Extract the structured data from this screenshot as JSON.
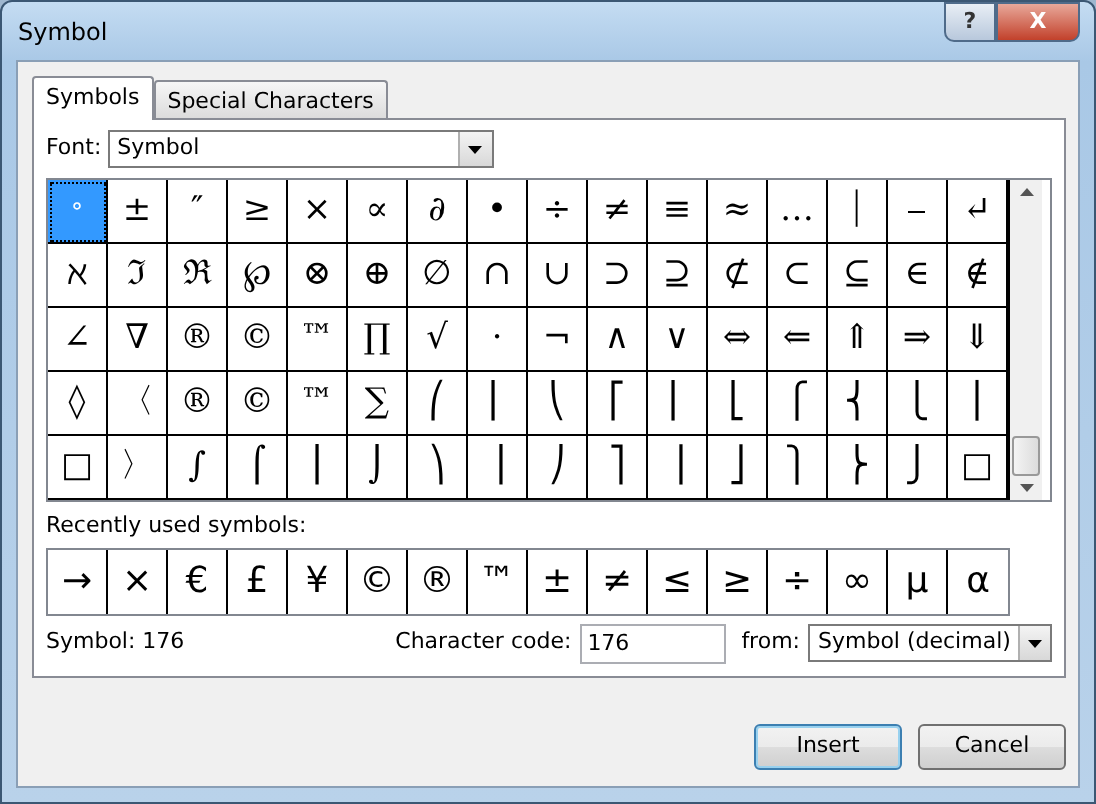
{
  "window": {
    "title": "Symbol",
    "help": "?",
    "close": "X"
  },
  "tabs": [
    {
      "label": "Symbols",
      "selected": true
    },
    {
      "label": "Special Characters",
      "selected": false
    }
  ],
  "font": {
    "label": "Font:",
    "value": "Symbol"
  },
  "grid": {
    "rows": [
      [
        {
          "symbol": "°",
          "selected": true
        },
        {
          "symbol": "±",
          "selected": false
        },
        {
          "symbol": "″",
          "selected": false
        },
        {
          "symbol": "≥",
          "selected": false
        },
        {
          "symbol": "×",
          "selected": false
        },
        {
          "symbol": "∝",
          "selected": false
        },
        {
          "symbol": "∂",
          "selected": false
        },
        {
          "symbol": "•",
          "selected": false
        },
        {
          "symbol": "÷",
          "selected": false
        },
        {
          "symbol": "≠",
          "selected": false
        },
        {
          "symbol": "≡",
          "selected": false
        },
        {
          "symbol": "≈",
          "selected": false
        },
        {
          "symbol": "…",
          "selected": false
        },
        {
          "symbol": "⏐",
          "selected": false
        },
        {
          "symbol": "⎯",
          "selected": false
        },
        {
          "symbol": "↵",
          "selected": false
        }
      ],
      [
        {
          "symbol": "ℵ",
          "selected": false
        },
        {
          "symbol": "ℑ",
          "selected": false
        },
        {
          "symbol": "ℜ",
          "selected": false
        },
        {
          "symbol": "℘",
          "selected": false
        },
        {
          "symbol": "⊗",
          "selected": false
        },
        {
          "symbol": "⊕",
          "selected": false
        },
        {
          "symbol": "∅",
          "selected": false
        },
        {
          "symbol": "∩",
          "selected": false
        },
        {
          "symbol": "∪",
          "selected": false
        },
        {
          "symbol": "⊃",
          "selected": false
        },
        {
          "symbol": "⊇",
          "selected": false
        },
        {
          "symbol": "⊄",
          "selected": false
        },
        {
          "symbol": "⊂",
          "selected": false
        },
        {
          "symbol": "⊆",
          "selected": false
        },
        {
          "symbol": "∈",
          "selected": false
        },
        {
          "symbol": "∉",
          "selected": false
        }
      ],
      [
        {
          "symbol": "∠",
          "selected": false
        },
        {
          "symbol": "∇",
          "selected": false
        },
        {
          "symbol": "®",
          "selected": false
        },
        {
          "symbol": "©",
          "selected": false
        },
        {
          "symbol": "™",
          "selected": false
        },
        {
          "symbol": "∏",
          "selected": false
        },
        {
          "symbol": "√",
          "selected": false
        },
        {
          "symbol": "⋅",
          "selected": false
        },
        {
          "symbol": "¬",
          "selected": false
        },
        {
          "symbol": "∧",
          "selected": false
        },
        {
          "symbol": "∨",
          "selected": false
        },
        {
          "symbol": "⇔",
          "selected": false
        },
        {
          "symbol": "⇐",
          "selected": false
        },
        {
          "symbol": "⇑",
          "selected": false
        },
        {
          "symbol": "⇒",
          "selected": false
        },
        {
          "symbol": "⇓",
          "selected": false
        }
      ],
      [
        {
          "symbol": "◊",
          "selected": false
        },
        {
          "symbol": "〈",
          "selected": false
        },
        {
          "symbol": "®",
          "selected": false
        },
        {
          "symbol": "©",
          "selected": false
        },
        {
          "symbol": "™",
          "selected": false
        },
        {
          "symbol": "∑",
          "selected": false
        },
        {
          "symbol": "⎛",
          "selected": false
        },
        {
          "symbol": "⎜",
          "selected": false
        },
        {
          "symbol": "⎝",
          "selected": false
        },
        {
          "symbol": "⎡",
          "selected": false
        },
        {
          "symbol": "⎢",
          "selected": false
        },
        {
          "symbol": "⎣",
          "selected": false
        },
        {
          "symbol": "⎧",
          "selected": false
        },
        {
          "symbol": "⎨",
          "selected": false
        },
        {
          "symbol": "⎩",
          "selected": false
        },
        {
          "symbol": "⎪",
          "selected": false
        }
      ],
      [
        {
          "symbol": "□",
          "selected": false
        },
        {
          "symbol": "〉",
          "selected": false
        },
        {
          "symbol": "∫",
          "selected": false
        },
        {
          "symbol": "⌠",
          "selected": false
        },
        {
          "symbol": "⎮",
          "selected": false
        },
        {
          "symbol": "⌡",
          "selected": false
        },
        {
          "symbol": "⎞",
          "selected": false
        },
        {
          "symbol": "⎟",
          "selected": false
        },
        {
          "symbol": "⎠",
          "selected": false
        },
        {
          "symbol": "⎤",
          "selected": false
        },
        {
          "symbol": "⎥",
          "selected": false
        },
        {
          "symbol": "⎦",
          "selected": false
        },
        {
          "symbol": "⎫",
          "selected": false
        },
        {
          "symbol": "⎬",
          "selected": false
        },
        {
          "symbol": "⎭",
          "selected": false
        },
        {
          "symbol": "□",
          "selected": false
        }
      ]
    ]
  },
  "recent": {
    "label": "Recently used symbols:",
    "symbols": [
      "→",
      "×",
      "€",
      "£",
      "¥",
      "©",
      "®",
      "™",
      "±",
      "≠",
      "≤",
      "≥",
      "÷",
      "∞",
      "µ",
      "α"
    ]
  },
  "status": {
    "symbol": "Symbol: 176",
    "code_label": "Character code:",
    "code_value": "176",
    "from_label": "from:",
    "from_value": "Symbol (decimal)"
  },
  "buttons": [
    {
      "label": "Insert",
      "default": true
    },
    {
      "label": "Cancel",
      "default": false
    }
  ]
}
